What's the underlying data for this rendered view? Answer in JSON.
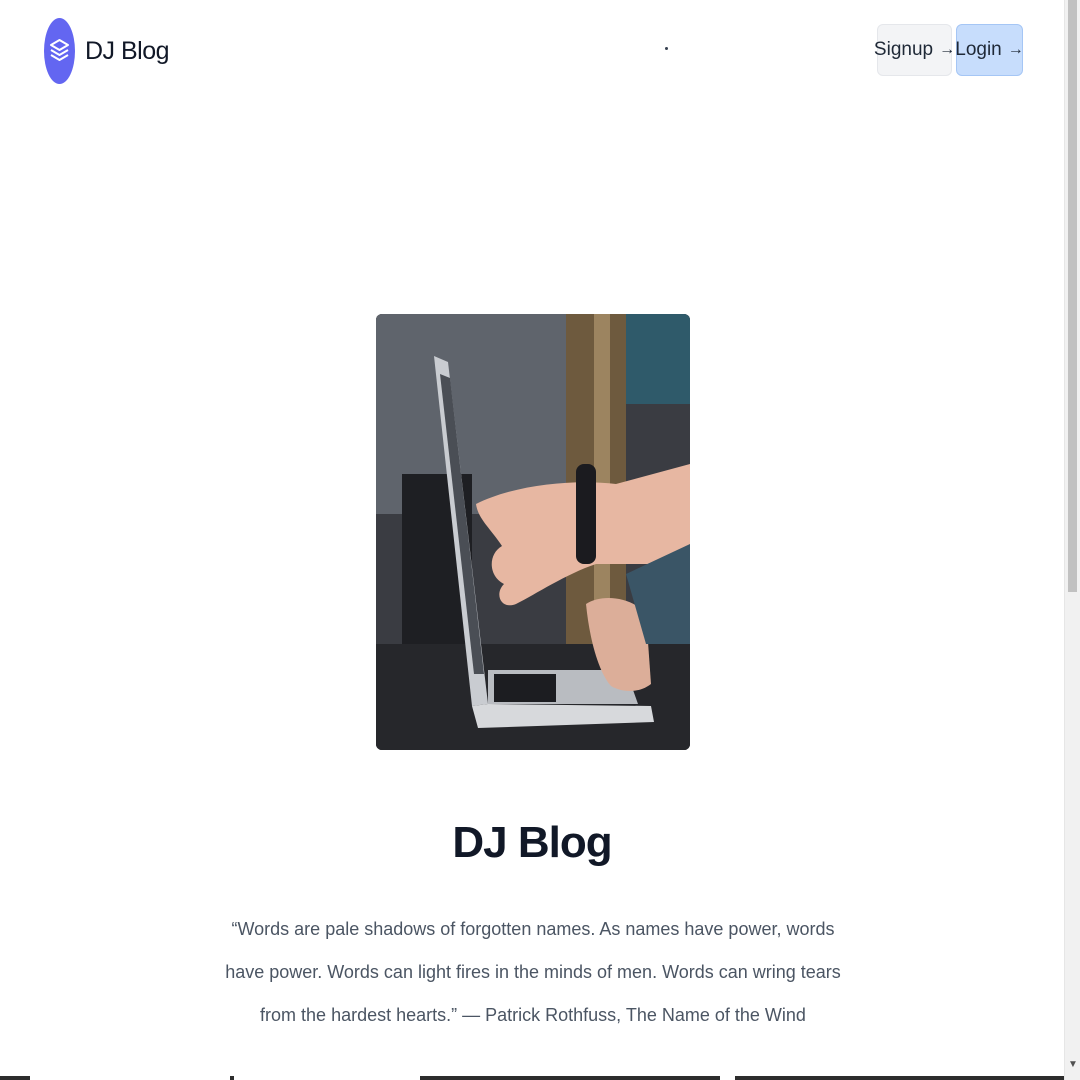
{
  "brand": {
    "name": "DJ Blog",
    "logo_icon": "layers-stack-icon",
    "accent_color": "#6366f1"
  },
  "nav": {
    "signup_label": "Signup",
    "login_label": "Login",
    "arrow_glyph": "→",
    "signup_bg": "#f3f4f6",
    "login_bg": "#c7ddfc"
  },
  "hero": {
    "image_icon": "laptop-hands-photo",
    "title": "DJ Blog",
    "quote": "“Words are pale shadows of forgotten names. As names have power, words have power. Words can light fires in the minds of men. Words can wring tears from the hardest hearts.” — Patrick Rothfuss, The Name of the Wind"
  },
  "scrollbar": {
    "down_arrow_icon": "chevron-down-icon"
  }
}
